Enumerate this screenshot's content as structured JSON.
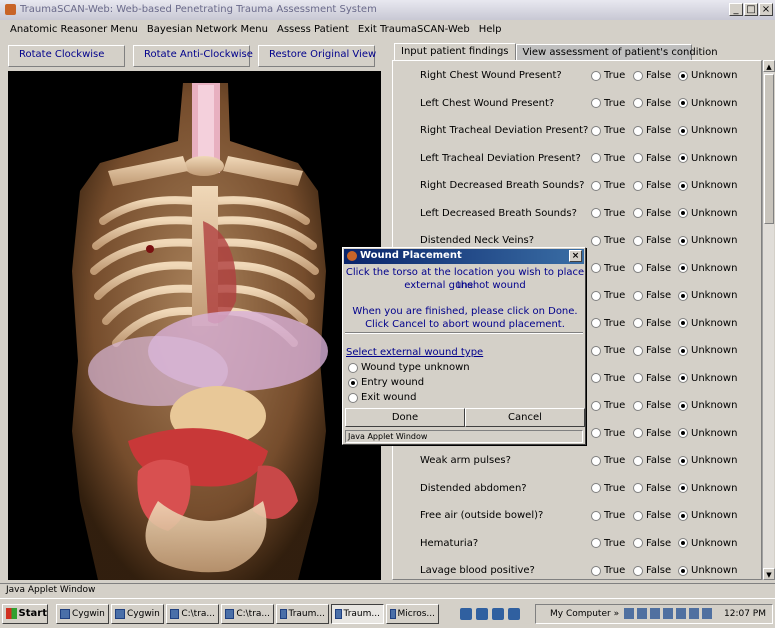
{
  "window": {
    "title": "TraumaSCAN-Web: Web-based Penetrating Trauma Assessment System",
    "controls": [
      "_",
      "□",
      "×"
    ]
  },
  "menu": [
    "Anatomic Reasoner Menu",
    "Bayesian Network Menu",
    "Assess Patient",
    "Exit TraumaSCAN-Web",
    "Help"
  ],
  "toolbar": {
    "rotate_cw": "Rotate Clockwise",
    "rotate_ccw": "Rotate Anti-Clockwise",
    "restore": "Restore Original View"
  },
  "tabs": [
    "Input patient findings",
    "View assessment of patient's condition"
  ],
  "options": [
    "True",
    "False",
    "Unknown"
  ],
  "findings": [
    {
      "q": "Right Chest Wound Present?",
      "sel": "Unknown"
    },
    {
      "q": "Left Chest Wound Present?",
      "sel": "Unknown"
    },
    {
      "q": "Right Tracheal Deviation Present?",
      "sel": "Unknown"
    },
    {
      "q": "Left Tracheal Deviation Present?",
      "sel": "Unknown"
    },
    {
      "q": "Right Decreased Breath Sounds?",
      "sel": "Unknown"
    },
    {
      "q": "Left Decreased Breath Sounds?",
      "sel": "Unknown"
    },
    {
      "q": "Distended Neck Veins?",
      "sel": "Unknown"
    },
    {
      "q": "",
      "sel": "Unknown"
    },
    {
      "q": "",
      "sel": "Unknown"
    },
    {
      "q": "",
      "sel": "Unknown"
    },
    {
      "q": "",
      "sel": "Unknown"
    },
    {
      "q": "",
      "sel": "Unknown"
    },
    {
      "q": "",
      "sel": "Unknown"
    },
    {
      "q": "",
      "sel": "Unknown"
    },
    {
      "q": "Weak arm pulses?",
      "sel": "Unknown"
    },
    {
      "q": "Distended abdomen?",
      "sel": "Unknown"
    },
    {
      "q": "Free air (outside bowel)?",
      "sel": "Unknown"
    },
    {
      "q": "Hematuria?",
      "sel": "Unknown"
    },
    {
      "q": "Lavage blood positive?",
      "sel": "Unknown"
    }
  ],
  "dialog": {
    "title": "Wound Placement",
    "close": "×",
    "msg1": "Click the torso at the location you wish to place the",
    "msg2": "external gunshot wound",
    "msg3": "When you are finished, please click on Done.",
    "msg4": "Click Cancel to abort wound placement.",
    "group_label": "Select external wound type",
    "wound_types": [
      "Wound type unknown",
      "Entry wound",
      "Exit wound"
    ],
    "selected_wound": "Entry wound",
    "done": "Done",
    "cancel": "Cancel",
    "status": "Java Applet Window"
  },
  "statusbar": "Java Applet Window",
  "taskbar": {
    "start": "Start",
    "tasks": [
      "Cygwin",
      "Cygwin",
      "C:\\tra...",
      "C:\\tra...",
      "Traum...",
      "Traum...",
      "Micros..."
    ],
    "active_task": 5,
    "chevron": "»",
    "tray_label": "My Computer",
    "clock": "12:07 PM"
  }
}
